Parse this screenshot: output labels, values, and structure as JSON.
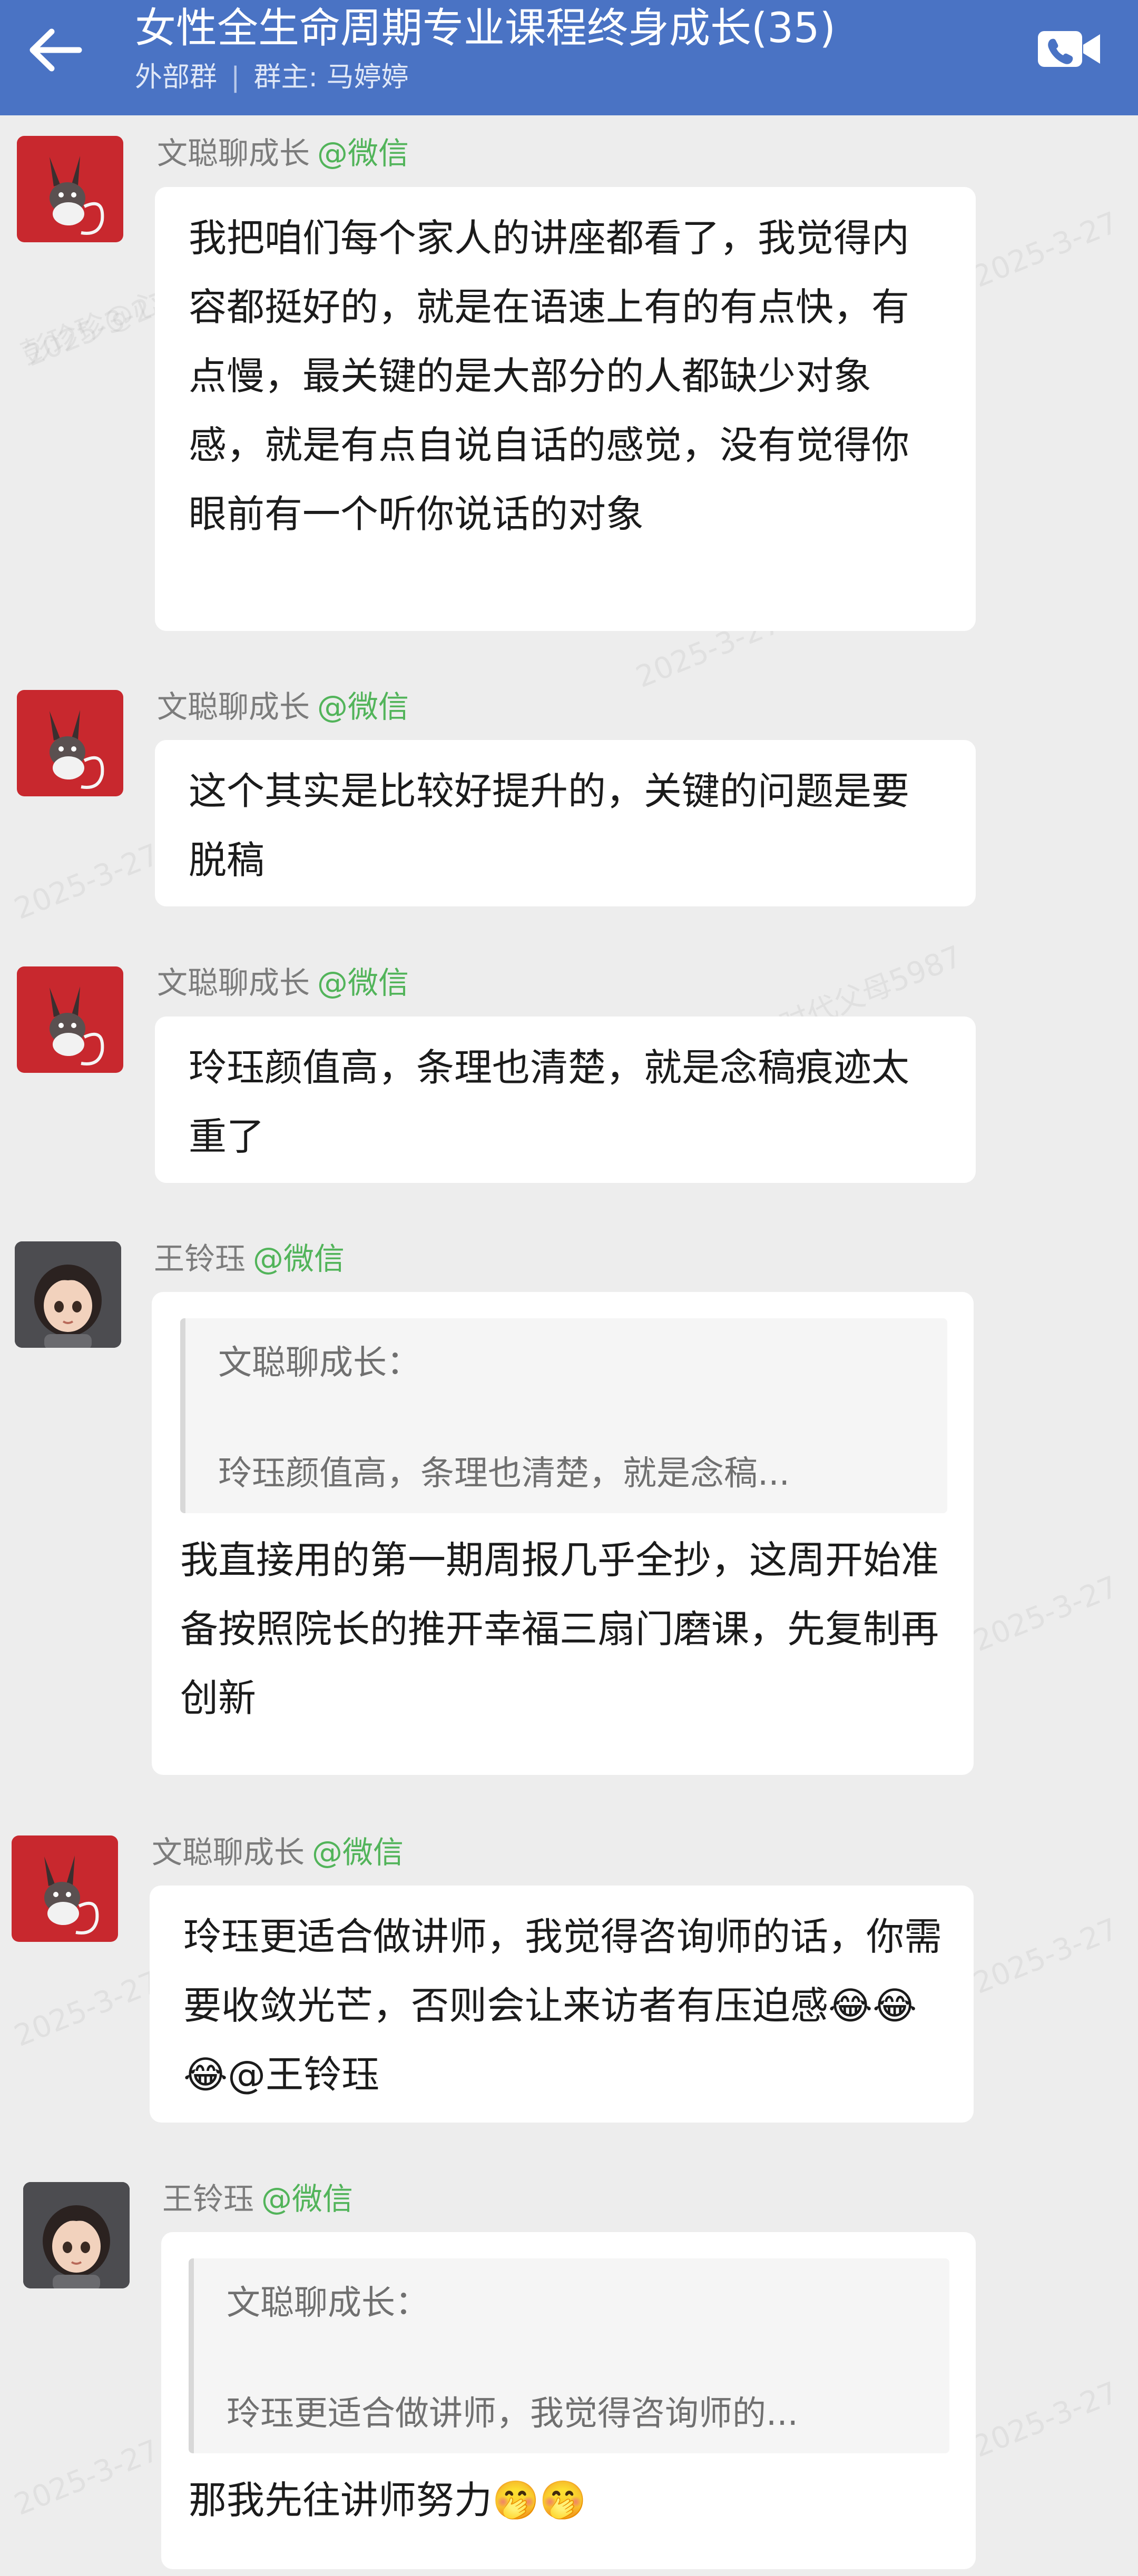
{
  "header": {
    "title": "女性全生命周期专业课程终身成长(35)",
    "group_type": "外部群",
    "owner_label": "群主: 马婷婷",
    "divider": "|"
  },
  "messages": [
    {
      "sender": "文聪聊成长",
      "source": "@微信",
      "avatar": "donkey-avatar",
      "text": "我把咱们每个家人的讲座都看了，我觉得内容都挺好的，就是在语速上有的有点快，有点慢，最关键的是大部分的人都缺少对象感，就是有点自说自话的感觉，没有觉得你眼前有一个听你说话的对象"
    },
    {
      "sender": "文聪聊成长",
      "source": "@微信",
      "avatar": "donkey-avatar",
      "text": "这个其实是比较好提升的，关键的问题是要脱稿"
    },
    {
      "sender": "文聪聊成长",
      "source": "@微信",
      "avatar": "donkey-avatar",
      "text": "玲珏颜值高，条理也清楚，就是念稿痕迹太重了"
    },
    {
      "sender": "王铃珏",
      "source": "@微信",
      "avatar": "girl-avatar",
      "quote_author": "文聪聊成长：",
      "quote_text": "玲珏颜值高，条理也清楚，就是念稿...",
      "text": "我直接用的第一期周报几乎全抄，这周开始准备按照院长的推开幸福三扇门磨课，先复制再创新"
    },
    {
      "sender": "文聪聊成长",
      "source": "@微信",
      "avatar": "donkey-avatar",
      "text": "玲珏更适合做讲师，我觉得咨询师的话，你需要收敛光芒，否则会让来访者有压迫感😂😂😂@王铃珏"
    },
    {
      "sender": "王铃珏",
      "source": "@微信",
      "avatar": "girl-avatar",
      "quote_author": "文聪聊成长：",
      "quote_text": "玲珏更适合做讲师，我觉得咨询师的...",
      "text": "那我先往讲师努力🤭🤭"
    }
  ],
  "watermarks": [
    "彭珍珍@心时代父母5987",
    "2025-3-27"
  ],
  "colors": {
    "header_bg": "#4a73c4",
    "source_green": "#52b45a",
    "page_bg": "#ededed",
    "bubble_bg": "#ffffff"
  }
}
